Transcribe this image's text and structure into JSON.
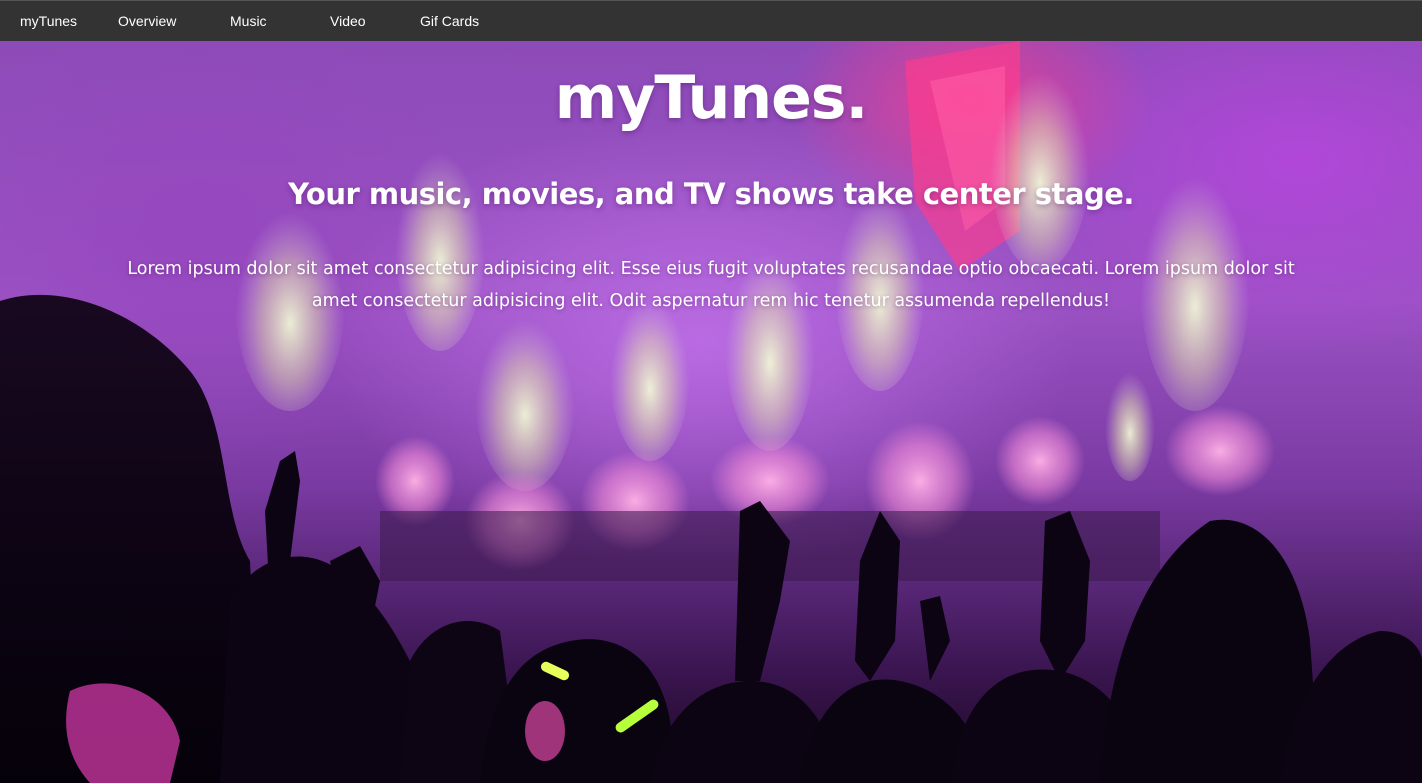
{
  "nav": {
    "brand": "myTunes",
    "items": [
      {
        "label": "Overview"
      },
      {
        "label": "Music"
      },
      {
        "label": "Video"
      },
      {
        "label": "Gif Cards"
      }
    ]
  },
  "hero": {
    "title": "myTunes.",
    "subtitle": "Your music, movies, and TV shows take center stage.",
    "text": "Lorem ipsum dolor sit amet consectetur adipisicing elit. Esse eius fugit voluptates recusandae optio obcaecati. Lorem ipsum dolor sit amet consectetur adipisicing elit. Odit aspernatur rem hic tenetur assumenda repellendus!",
    "background_image": "concert-crowd-image"
  },
  "colors": {
    "navbar_bg": "#333333",
    "nav_text": "#ffffff",
    "hero_purple": "#9b52c4",
    "stage_pink": "#ff3c8c"
  }
}
